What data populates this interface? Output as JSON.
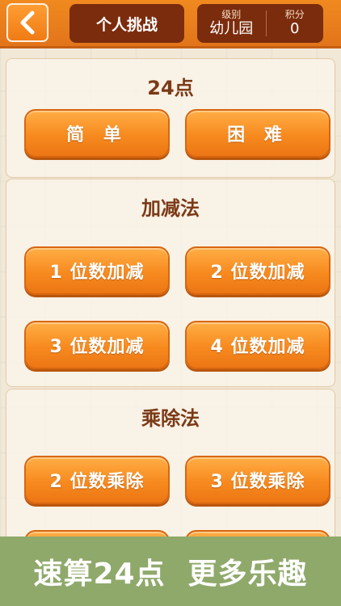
{
  "header": {
    "title": "个人挑战",
    "level_label": "级别",
    "level_value": "幼儿园",
    "score_label": "积分",
    "score_value": "0"
  },
  "sections": [
    {
      "title": "24点",
      "buttons": [
        "简 单",
        "困 难"
      ]
    },
    {
      "title": "加减法",
      "buttons": [
        "1 位数加减",
        "2 位数加减",
        "3 位数加减",
        "4 位数加减"
      ]
    },
    {
      "title": "乘除法",
      "buttons": [
        "2 位数乘除",
        "3 位数乘除"
      ]
    }
  ],
  "banner": {
    "left": "速算24点",
    "right": "更多乐趣"
  },
  "colors": {
    "header": "#e2741a",
    "title_box": "#7b2c0d",
    "button": "#f78a1f",
    "banner": "#8fa96b",
    "section_title": "#7b3a17"
  }
}
